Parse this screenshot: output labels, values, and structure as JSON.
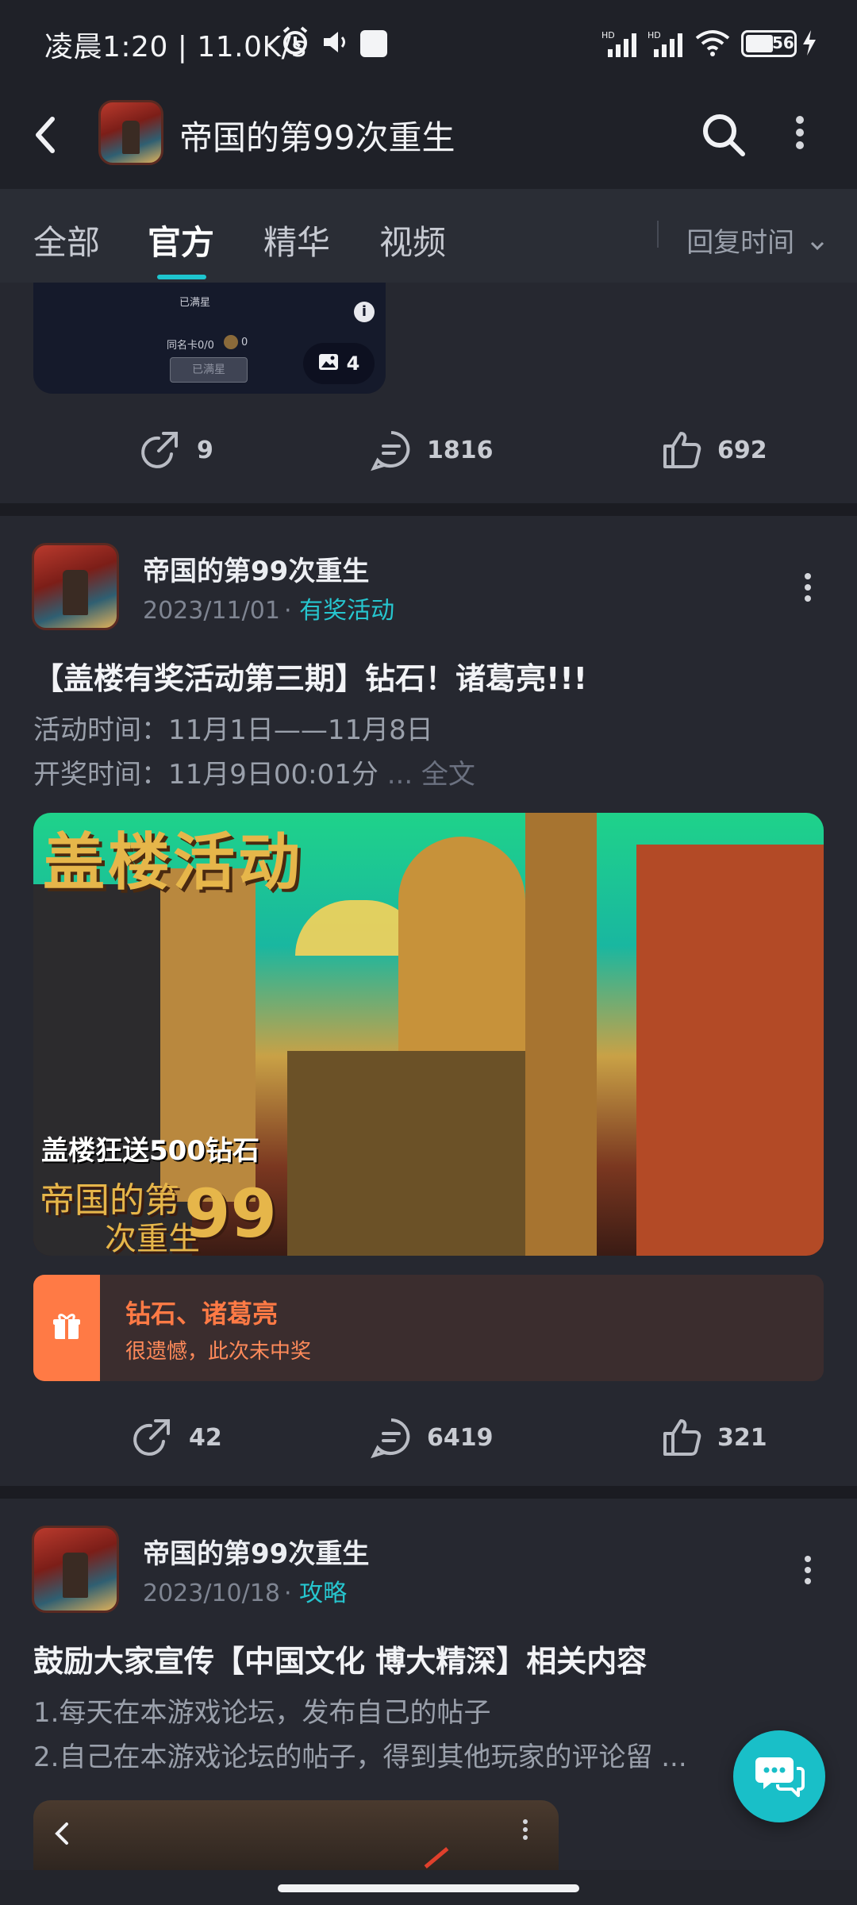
{
  "status_bar": {
    "time_text": "凌晨1:20 | 11.0K/s",
    "battery_text": "56"
  },
  "header": {
    "title": "帝国的第99次重生"
  },
  "tabs": [
    {
      "label": "全部"
    },
    {
      "label": "官方"
    },
    {
      "label": "精华"
    },
    {
      "label": "视频"
    }
  ],
  "sort": {
    "label": "回复时间"
  },
  "prev_post": {
    "image_overlay": {
      "line1": "已满星",
      "line2": "同名卡0/0",
      "line3": "0",
      "button": "已满星",
      "image_count": "4"
    },
    "shares": "9",
    "comments": "1816",
    "likes": "692"
  },
  "post1": {
    "author": "帝国的第99次重生",
    "date": "2023/11/01",
    "category": "有奖活动",
    "title": "【盖楼有奖活动第三期】钻石！诸葛亮!!!",
    "line1": "活动时间：11月1日——11月8日",
    "line2_prefix": "开奖时间：11月9日00:01分",
    "line2_suffix": " ... 全文",
    "banner_title": "盖楼活动",
    "banner_sub1": "盖楼狂送500钻石",
    "banner_sub2": "帝国的第",
    "banner_sub3": "次重生",
    "banner_num": "99",
    "prize_title": "钻石、诸葛亮",
    "prize_status": "很遗憾，此次未中奖",
    "shares": "42",
    "comments": "6419",
    "likes": "321"
  },
  "post2": {
    "author": "帝国的第99次重生",
    "date": "2023/10/18",
    "category": "攻略",
    "title": "鼓励大家宣传【中国文化 博大精深】相关内容",
    "line1": "1.每天在本游戏论坛，发布自己的帖子",
    "line2": "2.自己在本游戏论坛的帖子，得到其他玩家的评论留 ..."
  },
  "colors": {
    "accent": "#1ec5cf",
    "prize": "#ff7a45",
    "background": "#23252c"
  }
}
